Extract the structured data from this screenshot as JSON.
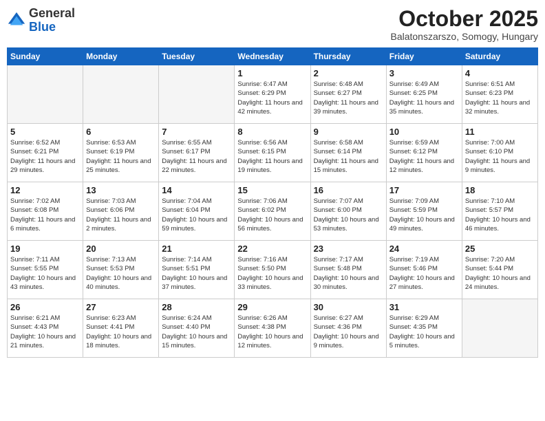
{
  "header": {
    "logo_general": "General",
    "logo_blue": "Blue",
    "month_title": "October 2025",
    "subtitle": "Balatonszarszo, Somogy, Hungary"
  },
  "weekdays": [
    "Sunday",
    "Monday",
    "Tuesday",
    "Wednesday",
    "Thursday",
    "Friday",
    "Saturday"
  ],
  "weeks": [
    [
      {
        "day": "",
        "info": ""
      },
      {
        "day": "",
        "info": ""
      },
      {
        "day": "",
        "info": ""
      },
      {
        "day": "1",
        "info": "Sunrise: 6:47 AM\nSunset: 6:29 PM\nDaylight: 11 hours\nand 42 minutes."
      },
      {
        "day": "2",
        "info": "Sunrise: 6:48 AM\nSunset: 6:27 PM\nDaylight: 11 hours\nand 39 minutes."
      },
      {
        "day": "3",
        "info": "Sunrise: 6:49 AM\nSunset: 6:25 PM\nDaylight: 11 hours\nand 35 minutes."
      },
      {
        "day": "4",
        "info": "Sunrise: 6:51 AM\nSunset: 6:23 PM\nDaylight: 11 hours\nand 32 minutes."
      }
    ],
    [
      {
        "day": "5",
        "info": "Sunrise: 6:52 AM\nSunset: 6:21 PM\nDaylight: 11 hours\nand 29 minutes."
      },
      {
        "day": "6",
        "info": "Sunrise: 6:53 AM\nSunset: 6:19 PM\nDaylight: 11 hours\nand 25 minutes."
      },
      {
        "day": "7",
        "info": "Sunrise: 6:55 AM\nSunset: 6:17 PM\nDaylight: 11 hours\nand 22 minutes."
      },
      {
        "day": "8",
        "info": "Sunrise: 6:56 AM\nSunset: 6:15 PM\nDaylight: 11 hours\nand 19 minutes."
      },
      {
        "day": "9",
        "info": "Sunrise: 6:58 AM\nSunset: 6:14 PM\nDaylight: 11 hours\nand 15 minutes."
      },
      {
        "day": "10",
        "info": "Sunrise: 6:59 AM\nSunset: 6:12 PM\nDaylight: 11 hours\nand 12 minutes."
      },
      {
        "day": "11",
        "info": "Sunrise: 7:00 AM\nSunset: 6:10 PM\nDaylight: 11 hours\nand 9 minutes."
      }
    ],
    [
      {
        "day": "12",
        "info": "Sunrise: 7:02 AM\nSunset: 6:08 PM\nDaylight: 11 hours\nand 6 minutes."
      },
      {
        "day": "13",
        "info": "Sunrise: 7:03 AM\nSunset: 6:06 PM\nDaylight: 11 hours\nand 2 minutes."
      },
      {
        "day": "14",
        "info": "Sunrise: 7:04 AM\nSunset: 6:04 PM\nDaylight: 10 hours\nand 59 minutes."
      },
      {
        "day": "15",
        "info": "Sunrise: 7:06 AM\nSunset: 6:02 PM\nDaylight: 10 hours\nand 56 minutes."
      },
      {
        "day": "16",
        "info": "Sunrise: 7:07 AM\nSunset: 6:00 PM\nDaylight: 10 hours\nand 53 minutes."
      },
      {
        "day": "17",
        "info": "Sunrise: 7:09 AM\nSunset: 5:59 PM\nDaylight: 10 hours\nand 49 minutes."
      },
      {
        "day": "18",
        "info": "Sunrise: 7:10 AM\nSunset: 5:57 PM\nDaylight: 10 hours\nand 46 minutes."
      }
    ],
    [
      {
        "day": "19",
        "info": "Sunrise: 7:11 AM\nSunset: 5:55 PM\nDaylight: 10 hours\nand 43 minutes."
      },
      {
        "day": "20",
        "info": "Sunrise: 7:13 AM\nSunset: 5:53 PM\nDaylight: 10 hours\nand 40 minutes."
      },
      {
        "day": "21",
        "info": "Sunrise: 7:14 AM\nSunset: 5:51 PM\nDaylight: 10 hours\nand 37 minutes."
      },
      {
        "day": "22",
        "info": "Sunrise: 7:16 AM\nSunset: 5:50 PM\nDaylight: 10 hours\nand 33 minutes."
      },
      {
        "day": "23",
        "info": "Sunrise: 7:17 AM\nSunset: 5:48 PM\nDaylight: 10 hours\nand 30 minutes."
      },
      {
        "day": "24",
        "info": "Sunrise: 7:19 AM\nSunset: 5:46 PM\nDaylight: 10 hours\nand 27 minutes."
      },
      {
        "day": "25",
        "info": "Sunrise: 7:20 AM\nSunset: 5:44 PM\nDaylight: 10 hours\nand 24 minutes."
      }
    ],
    [
      {
        "day": "26",
        "info": "Sunrise: 6:21 AM\nSunset: 4:43 PM\nDaylight: 10 hours\nand 21 minutes."
      },
      {
        "day": "27",
        "info": "Sunrise: 6:23 AM\nSunset: 4:41 PM\nDaylight: 10 hours\nand 18 minutes."
      },
      {
        "day": "28",
        "info": "Sunrise: 6:24 AM\nSunset: 4:40 PM\nDaylight: 10 hours\nand 15 minutes."
      },
      {
        "day": "29",
        "info": "Sunrise: 6:26 AM\nSunset: 4:38 PM\nDaylight: 10 hours\nand 12 minutes."
      },
      {
        "day": "30",
        "info": "Sunrise: 6:27 AM\nSunset: 4:36 PM\nDaylight: 10 hours\nand 9 minutes."
      },
      {
        "day": "31",
        "info": "Sunrise: 6:29 AM\nSunset: 4:35 PM\nDaylight: 10 hours\nand 5 minutes."
      },
      {
        "day": "",
        "info": ""
      }
    ]
  ]
}
